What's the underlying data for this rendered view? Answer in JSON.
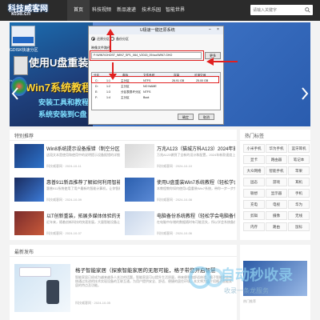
{
  "header": {
    "logo_text": "科技威客网",
    "logo_domain": "kt58.cn",
    "nav": [
      {
        "label": "首页",
        "active": true
      },
      {
        "label": "科技视频",
        "active": false
      },
      {
        "label": "新品速递",
        "active": false
      },
      {
        "label": "技术乐园",
        "active": false
      },
      {
        "label": "智能世界",
        "active": false
      }
    ],
    "search_placeholder": "请输入关键字"
  },
  "banner": {
    "left_label": "GDISK快速分区",
    "left_tool": "DiskGenius",
    "headline_1": "使用U盘重装",
    "headline_2": "Win7系统教程",
    "sub_1": "安装工具和教程",
    "sub_2": "系统安装到C盘",
    "dialog": {
      "title": "U极速一键还原系统",
      "restore_label": "还原分区",
      "backup_label": "备份分区",
      "image_label": "映像文件路径",
      "path": "F:\\WIN7\\GHOST_WIN7_SP1_X64_V2015_09.iso\\WIN7.GHO",
      "browse_label": "更多",
      "table_headers": [
        "分区",
        "卷标",
        "文件系统",
        "容量",
        "可用空间"
      ],
      "rows": [
        [
          "C:",
          "1:1",
          "主分区",
          "NTFS",
          "26.91 GB",
          "25.00 GB"
        ],
        [
          "D:",
          "1:2",
          "主分区",
          "NO NAME",
          "",
          ""
        ],
        [
          "E:",
          "1:3",
          "分区表损坏分区",
          "NTFS",
          "",
          ""
        ],
        [
          "F:",
          "1:4",
          "主分区",
          "Boot",
          "",
          ""
        ]
      ],
      "ok_label": "确定",
      "cancel_label": "取消"
    }
  },
  "featured": {
    "title": "特别推荐",
    "articles": [
      {
        "title": "Win8系统提示设备报错（制空分区导致无线网络问题）",
        "desc": "这段文本是使用和使用中的说明提示设备报错的详细解决办法说明",
        "meta": "科技威客网 · 2024-10-11"
      },
      {
        "title": "万兆A123（猫城方科A123）2024年的新..",
        "desc": "万兆A123做到了全新的设计和配置，2024年新款速度上有了很大提升",
        "meta": "科技威客网 · 2024-10-10"
      },
      {
        "title": "惠普911新品推荐了解如何利用智能电脑来",
        "desc": "惠普911系统使用了用户最新的智能计算机，让你智能地使用到新品",
        "meta": "科技威客网 · 2024-10-09"
      },
      {
        "title": "使用U盘重装Win7系统教程（轻松学会做..",
        "desc": "本教程教你如何使用U盘重装Win7系统，带你一步一步完成安装",
        "meta": "科技威客网 · 2024-10-08"
      },
      {
        "title": "以T创新重装，拓展多媒体体验的无限可能（更",
        "desc": "近年来，随着创新科技的快速发展，大量智能设备让人们的生活更方便",
        "meta": "科技威客网 · 2024-10-07"
      },
      {
        "title": "电脑备份系统教程（轻松学会电脑备份系统）",
        "desc": "在电脑中存储的数据随时有可能丢失，所以学会系统备份是很重要的",
        "meta": "科技威客网 · 2024-10-06"
      }
    ]
  },
  "latest": {
    "title": "最新发布",
    "article": {
      "title": "格子智能家居（探索智能家居的无限可能，格子带您开启智慧",
      "desc": "智能家居已经成为越来越多人关注的话题，智能家居可以提升生活质量，带来便利和舒适体验，格子智能家居系统通过先进的技术实现设备的互联互通，为用户提供安全、舒适、便捷的居住环境，本文将为您介绍格子智能家居的特点及功能。",
      "meta": "科技威客网 · 2024-10-05"
    }
  },
  "sidebar": {
    "hot_title": "热门标签",
    "tags": [
      "小米手机",
      "华为手机",
      "蓝牙耳机",
      "显卡",
      "路由器",
      "笔记本",
      "大众网络",
      "智能手机",
      "苹果",
      "固态",
      "游戏",
      "耳机",
      "联想",
      "显示器",
      "手机",
      "充电",
      "电视",
      "华为",
      "剪辑",
      "摄像",
      "无线",
      "内存",
      "路由",
      "鼠标"
    ],
    "latest_label": "热门推荐"
  },
  "watermark": {
    "line_1": "自动秒收录",
    "line_2": "收录一条龙服务"
  }
}
